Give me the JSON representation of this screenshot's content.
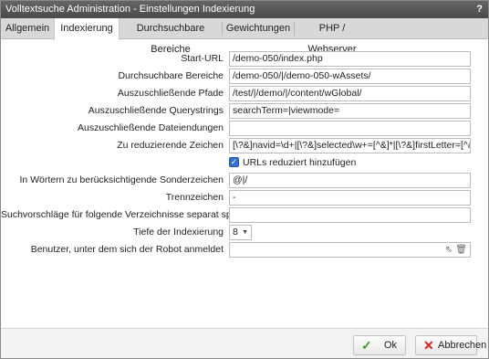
{
  "window": {
    "title": "Volltextsuche Administration - Einstellungen Indexierung",
    "help": "?"
  },
  "tabs": [
    {
      "label": "Allgemein"
    },
    {
      "label": "Indexierung"
    },
    {
      "label": "Durchsuchbare Bereiche"
    },
    {
      "label": "Gewichtungen"
    },
    {
      "label": "PHP / Webserver"
    }
  ],
  "active_tab": "Indexierung",
  "form": {
    "start_url": {
      "label": "Start-URL",
      "value": "/demo-050/index.php"
    },
    "searchable_areas": {
      "label": "Durchsuchbare Bereiche",
      "value": "/demo-050/|/demo-050-wAssets/"
    },
    "excluded_paths": {
      "label": "Auszuschließende Pfade",
      "value": "/test/|/demo/|/content/wGlobal/"
    },
    "excluded_querystrings": {
      "label": "Auszuschließende Querystrings",
      "value": "searchTerm=|viewmode="
    },
    "excluded_extensions": {
      "label": "Auszuschließende Dateiendungen",
      "value": ""
    },
    "reduce_chars": {
      "label": "Zu reduzierende Zeichen",
      "value": "[\\?&]navid=\\d+|[\\?&]selected\\w+=[^&]*|[\\?&]firstLetter=[^&]*"
    },
    "add_reduced_urls": {
      "label": "URLs reduziert hinzufügen",
      "checked": true
    },
    "special_chars": {
      "label": "In Wörtern zu berücksichtigende Sonderzeichen",
      "value": "@|/"
    },
    "separators": {
      "label": "Trennzeichen",
      "value": "-"
    },
    "suggest_dirs": {
      "label": "Suchvorschläge für folgende Verzeichnisse separat speichern",
      "value": ""
    },
    "depth": {
      "label": "Tiefe der Indexierung",
      "value": "8"
    },
    "robot_user": {
      "label": "Benutzer, unter dem sich der Robot anmeldet",
      "value": ""
    }
  },
  "footer": {
    "ok_label": "Ok",
    "cancel_label": "Abbrechen"
  },
  "colors": {
    "titlebar": "#555555",
    "tabbar": "#d8d8d8",
    "checkbox": "#2f6fd6",
    "ok_icon": "#3c9a2a",
    "cancel_icon": "#d22222"
  },
  "icons": {
    "help": "question-mark",
    "checkbox": "checkmark",
    "select": "chevron-down",
    "user_pick": "cursor-arrow",
    "user_clear": "trash",
    "ok": "checkmark",
    "cancel": "x"
  }
}
